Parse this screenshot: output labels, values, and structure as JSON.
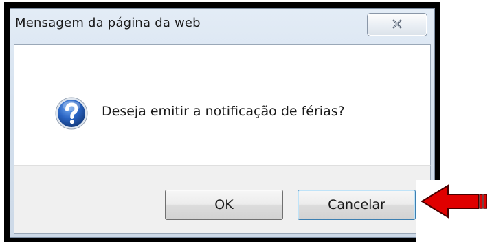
{
  "dialog": {
    "title": "Mensagem da página da web",
    "message": "Deseja emitir a notificação de férias?",
    "icon": "question-icon",
    "close_icon": "close-icon",
    "ok_label": "OK",
    "cancel_label": "Cancelar"
  },
  "annotation": {
    "icon": "red-arrow-left-icon",
    "color": "#e00000"
  },
  "colors": {
    "titlebar": "#d6e2ef",
    "content_bg": "#ffffff",
    "footer_bg": "#f0f0f0",
    "icon_blue": "#1f55a8",
    "default_button_border": "#3c7fb1"
  }
}
